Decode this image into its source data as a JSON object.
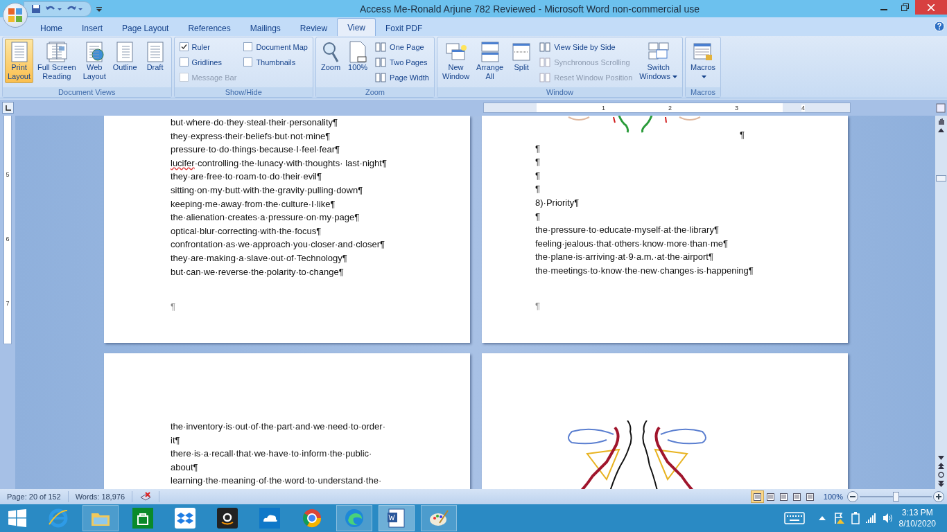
{
  "window": {
    "title": "Access Me-Ronald Arjune 782 Reviewed - Microsoft Word non-commercial use"
  },
  "tabs": [
    {
      "label": "Home",
      "selected": false
    },
    {
      "label": "Insert",
      "selected": false
    },
    {
      "label": "Page Layout",
      "selected": false
    },
    {
      "label": "References",
      "selected": false
    },
    {
      "label": "Mailings",
      "selected": false
    },
    {
      "label": "Review",
      "selected": false
    },
    {
      "label": "View",
      "selected": true
    },
    {
      "label": "Foxit PDF",
      "selected": false
    }
  ],
  "ribbon": [
    {
      "label": "Document Views",
      "items": [
        {
          "kind": "large",
          "lines": [
            "Print",
            "Layout"
          ],
          "selected": true
        },
        {
          "kind": "large",
          "lines": [
            "Full Screen",
            "Reading"
          ],
          "selected": false
        },
        {
          "kind": "large",
          "lines": [
            "Web",
            "Layout"
          ],
          "selected": false
        },
        {
          "kind": "large",
          "lines": [
            "Outline"
          ],
          "selected": false
        },
        {
          "kind": "large",
          "lines": [
            "Draft"
          ],
          "selected": false
        }
      ]
    },
    {
      "label": "Show/Hide",
      "items": [
        {
          "kind": "stack",
          "entries": [
            {
              "kind": "check",
              "label": "Ruler",
              "checked": true,
              "disabled": false
            },
            {
              "kind": "check",
              "label": "Gridlines",
              "checked": false,
              "disabled": false
            },
            {
              "kind": "check",
              "label": "Message Bar",
              "checked": false,
              "disabled": true
            }
          ]
        },
        {
          "kind": "stack",
          "entries": [
            {
              "kind": "check",
              "label": "Document Map",
              "checked": false,
              "disabled": false
            },
            {
              "kind": "check",
              "label": "Thumbnails",
              "checked": false,
              "disabled": false
            }
          ]
        }
      ]
    },
    {
      "label": "Zoom",
      "items": [
        {
          "kind": "large",
          "lines": [
            "Zoom"
          ],
          "selected": false
        },
        {
          "kind": "large",
          "lines": [
            "100%"
          ],
          "selected": false
        },
        {
          "kind": "stack",
          "entries": [
            {
              "kind": "small",
              "label": "One Page",
              "disabled": false
            },
            {
              "kind": "small",
              "label": "Two Pages",
              "disabled": false
            },
            {
              "kind": "small",
              "label": "Page Width",
              "disabled": false
            }
          ]
        }
      ]
    },
    {
      "label": "Window",
      "items": [
        {
          "kind": "large",
          "lines": [
            "New",
            "Window"
          ],
          "selected": false
        },
        {
          "kind": "large",
          "lines": [
            "Arrange",
            "All"
          ],
          "selected": false
        },
        {
          "kind": "large",
          "lines": [
            "Split"
          ],
          "selected": false
        },
        {
          "kind": "stack",
          "entries": [
            {
              "kind": "small",
              "label": "View Side by Side",
              "disabled": false
            },
            {
              "kind": "small",
              "label": "Synchronous Scrolling",
              "disabled": true
            },
            {
              "kind": "small",
              "label": "Reset Window Position",
              "disabled": true
            }
          ]
        },
        {
          "kind": "large",
          "lines": [
            "Switch",
            "Windows"
          ],
          "selected": false,
          "dropdown": true
        }
      ]
    },
    {
      "label": "Macros",
      "items": [
        {
          "kind": "large",
          "lines": [
            "Macros"
          ],
          "selected": false,
          "dropdown": true
        }
      ]
    }
  ],
  "ruler": {
    "marks": [
      "1",
      "2",
      "3",
      "4"
    ],
    "vertical_marks": [
      "5",
      "6",
      "7"
    ]
  },
  "pages": [
    {
      "lines": [
        "but·where·do·they·steal·their·personality¶",
        "they·express·their·beliefs·but·not·mine¶",
        "pressure·to·do·things·because·I·feel·fear¶",
        "lucifer·controlling·the·lunacy·with·thoughts· last·night¶",
        "they·are·free·to·roam·to·do·their·evil¶",
        "sitting·on·my·butt·with·the·gravity·pulling·down¶",
        "keeping·me·away·from·the·culture·I·like¶",
        "the·alienation·creates·a·pressure·on·my·page¶",
        "optical·blur·correcting·with·the·focus¶",
        "confrontation·as·we·approach·you·closer·and·closer¶",
        "they·are·making·a·slave·out·of·Technology¶",
        "but·can·we·reverse·the·polarity·to·change¶"
      ],
      "end_mark": "¶"
    },
    {
      "anchor_mark": "¶",
      "lines": [
        "¶",
        "¶",
        "¶",
        "¶",
        "8)·Priority¶",
        "¶",
        "the·pressure·to·educate·myself·at·the·library¶",
        "feeling·jealous·that·others·know·more·than·me¶",
        "the·plane·is·arriving·at·9·a.m.·at·the·airport¶",
        "the·meetings·to·know·the·new·changes·is·happening¶"
      ],
      "end_mark": "¶"
    },
    {
      "lines": [
        "the·inventory·is·out·of·the·part·and·we·need·to·order·",
        "it¶",
        "there·is·a·recall·that·we·have·to·inform·the·public·",
        "about¶",
        "learning·the·meaning·of·the·word·to·understand·the·"
      ]
    }
  ],
  "status_bar": {
    "page": "Page: 20 of 152",
    "words": "Words: 18,976",
    "views": [
      {
        "selected": true
      },
      {
        "selected": false
      },
      {
        "selected": false
      },
      {
        "selected": false
      },
      {
        "selected": false
      }
    ],
    "zoom": "100%",
    "zoom_slider": {
      "level": 0.5
    }
  },
  "taskbar": {
    "apps": [
      {
        "running": false,
        "selected": false
      },
      {
        "running": true,
        "selected": false
      },
      {
        "running": false,
        "selected": false
      },
      {
        "running": false,
        "selected": false
      },
      {
        "running": false,
        "selected": false
      },
      {
        "running": false,
        "selected": false
      },
      {
        "running": false,
        "selected": false
      },
      {
        "running": true,
        "selected": false
      },
      {
        "running": true,
        "selected": true
      },
      {
        "running": true,
        "selected": false
      }
    ],
    "time": "3:13 PM",
    "date": "8/10/2020"
  }
}
